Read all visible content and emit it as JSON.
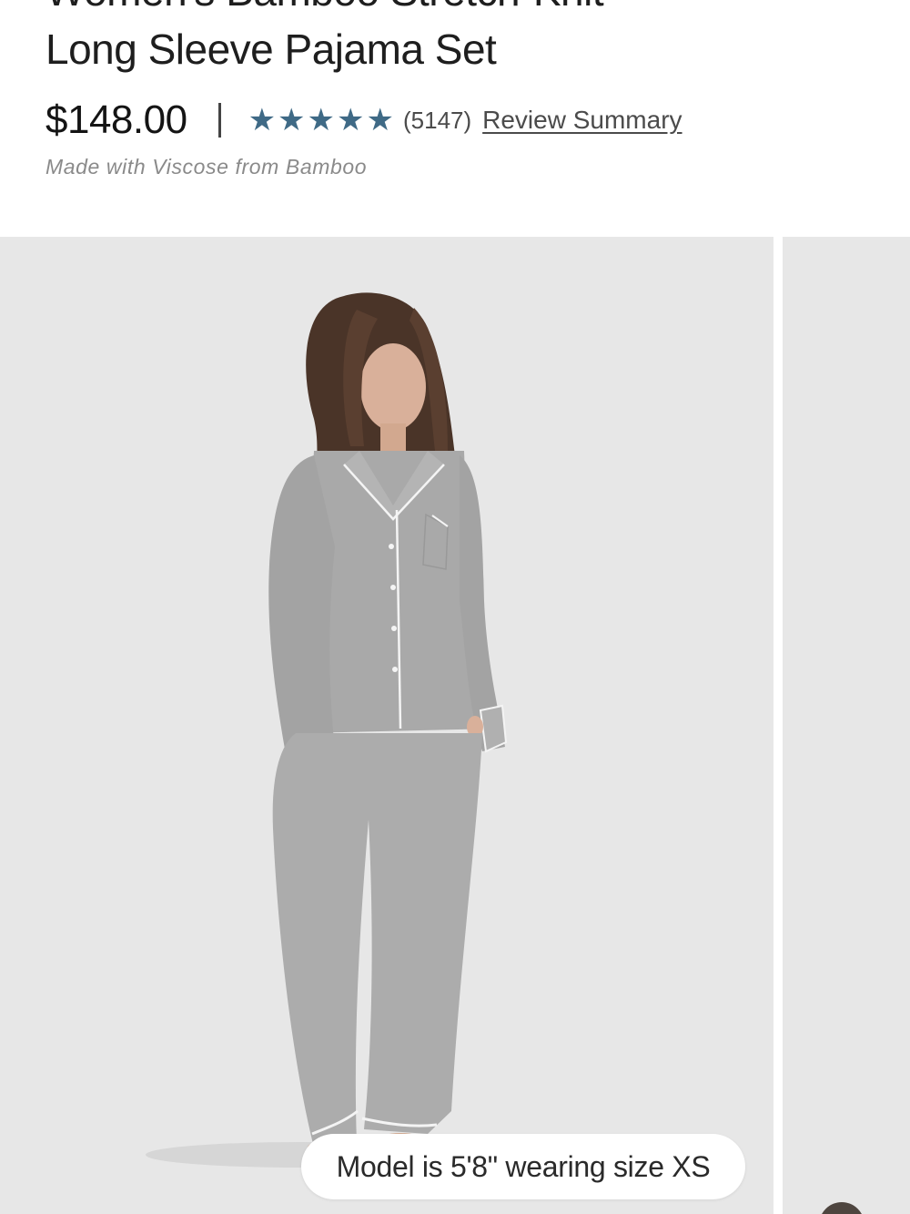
{
  "product": {
    "title_line1": "Women's Bamboo Stretch-Knit",
    "title_line2": "Long Sleeve Pajama Set",
    "price": "$148.00",
    "rating_stars": 5,
    "review_count": "(5147)",
    "review_link": "Review Summary",
    "material": "Made with Viscose from Bamboo"
  },
  "gallery": {
    "caption": "Model is 5'8\" wearing size XS"
  },
  "colors": {
    "star": "#3f6a86",
    "image_bg": "#e7e7e7",
    "pajama": "#a9a9a9",
    "piping": "#f4f4f4"
  },
  "icons": {
    "star": "star-icon"
  }
}
